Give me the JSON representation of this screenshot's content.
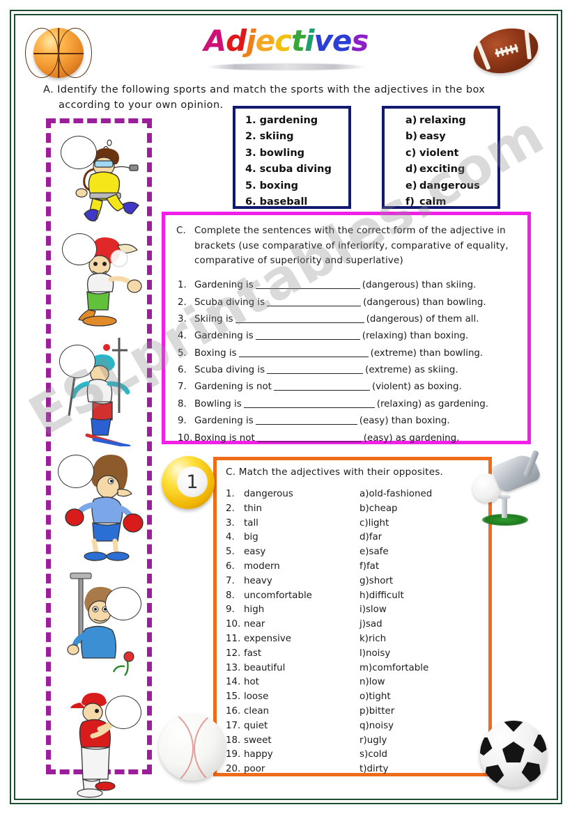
{
  "title": {
    "text": "Adjectives",
    "letters": [
      {
        "ch": "A",
        "color": "#cc1177"
      },
      {
        "ch": "d",
        "color": "#e01a1a"
      },
      {
        "ch": "j",
        "color": "#ef7d18"
      },
      {
        "ch": "e",
        "color": "#f5a623"
      },
      {
        "ch": "c",
        "color": "#f2c012"
      },
      {
        "ch": "t",
        "color": "#3aa63a"
      },
      {
        "ch": "i",
        "color": "#1f9e6e"
      },
      {
        "ch": "v",
        "color": "#2b3fd4"
      },
      {
        "ch": "e",
        "color": "#2b3fd4"
      },
      {
        "ch": "s",
        "color": "#8d1fc9"
      }
    ]
  },
  "decorations": {
    "basketball": "basketball-icon",
    "football": "american-football-icon",
    "soccer_ball": "soccer-ball-icon",
    "baseball": "baseball-icon",
    "billiard_ball_number": "1",
    "golf": "golf-club-and-ball-icon"
  },
  "watermark": {
    "text": "ESLprintables.com"
  },
  "section_a": {
    "line1": "A.  Identify  the  following  sports  and  match  the  sports  with  the  adjectives  in  the  box",
    "line2": "according to your own opinion.",
    "sports_box": {
      "items": [
        "1. gardening",
        "2. skiing",
        "3. bowling",
        "4. scuba diving",
        "5. boxing",
        "6. baseball"
      ]
    },
    "adjectives_box": {
      "items": [
        {
          "label": "a)",
          "word": "relaxing"
        },
        {
          "label": "b)",
          "word": "easy"
        },
        {
          "label": "c)",
          "word": "violent"
        },
        {
          "label": "d)",
          "word": "exciting"
        },
        {
          "label": "e)",
          "word": "dangerous"
        },
        {
          "label": "f)",
          "word": "calm"
        }
      ]
    },
    "illustrations": [
      {
        "name": "scuba-diver-illustration",
        "sport": "scuba diving"
      },
      {
        "name": "bowling-player-illustration",
        "sport": "bowling"
      },
      {
        "name": "skier-illustration",
        "sport": "skiing"
      },
      {
        "name": "boxer-illustration",
        "sport": "boxing"
      },
      {
        "name": "gardener-illustration",
        "sport": "gardening"
      },
      {
        "name": "baseball-batter-illustration",
        "sport": "baseball"
      }
    ]
  },
  "section_c_sentences": {
    "instruction_letter": "C.",
    "instruction_line1": "Complete the sentences with the correct form of the adjective in",
    "instruction_line2": "brackets (use comparative of inferiority, comparative of equality,",
    "instruction_line3": "comparative of superiority and superlative)",
    "items": [
      {
        "num": "1.",
        "before": "Gardening is",
        "blank_width": 150,
        "after": "(dangerous) than skiing."
      },
      {
        "num": "2.",
        "before": "Scuba diving is",
        "blank_width": 135,
        "after": "(dangerous) than bowling."
      },
      {
        "num": "3.",
        "before": "Skiing is",
        "blank_width": 185,
        "after": "(dangerous) of them all."
      },
      {
        "num": "4.",
        "before": "Gardening is",
        "blank_width": 150,
        "after": "(relaxing) than boxing."
      },
      {
        "num": "5.",
        "before": "Boxing is",
        "blank_width": 186,
        "after": "(extreme) than bowling."
      },
      {
        "num": "6.",
        "before": "Scuba diving is",
        "blank_width": 138,
        "after": "(extreme) as skiing."
      },
      {
        "num": "7.",
        "before": "Gardening is not",
        "blank_width": 138,
        "after": "(violent) as boxing."
      },
      {
        "num": "8.",
        "before": "Bowling is",
        "blank_width": 188,
        "after": "(relaxing) as gardening."
      },
      {
        "num": "9.",
        "before": "Gardening is",
        "blank_width": 146,
        "after": "(easy) than boxing."
      },
      {
        "num": "10.",
        "before": "Boxing is not",
        "blank_width": 150,
        "after": "(easy) as gardening."
      }
    ]
  },
  "section_c_matching": {
    "instruction": "C. Match the adjectives with their opposites.",
    "rows": [
      {
        "num": "1.",
        "word": "dangerous",
        "opt": "a)",
        "opposite": "old-fashioned"
      },
      {
        "num": "2.",
        "word": "thin",
        "opt": "b)",
        "opposite": "cheap"
      },
      {
        "num": "3.",
        "word": "tall",
        "opt": "c)",
        "opposite": "light"
      },
      {
        "num": "4.",
        "word": "big",
        "opt": "d)",
        "opposite": "far"
      },
      {
        "num": "5.",
        "word": "easy",
        "opt": "e)",
        "opposite": "safe"
      },
      {
        "num": "6.",
        "word": "modern",
        "opt": "f)",
        "opposite": "fat"
      },
      {
        "num": "7.",
        "word": "heavy",
        "opt": "g)",
        "opposite": "short"
      },
      {
        "num": "8.",
        "word": "uncomfortable",
        "opt": "h)",
        "opposite": "difficult"
      },
      {
        "num": "9.",
        "word": "high",
        "opt": "i)",
        "opposite": "slow"
      },
      {
        "num": "10.",
        "word": "near",
        "opt": "j)",
        "opposite": "sad"
      },
      {
        "num": "11.",
        "word": "expensive",
        "opt": "k)",
        "opposite": "rich"
      },
      {
        "num": "12.",
        "word": "fast",
        "opt": "l)",
        "opposite": "noisy"
      },
      {
        "num": "13.",
        "word": "beautiful",
        "opt": "m)",
        "opposite": "comfortable"
      },
      {
        "num": "14.",
        "word": "hot",
        "opt": "n)",
        "opposite": "low"
      },
      {
        "num": "15.",
        "word": "loose",
        "opt": "o)",
        "opposite": "tight"
      },
      {
        "num": "16.",
        "word": "clean",
        "opt": "p)",
        "opposite": "bitter"
      },
      {
        "num": "17.",
        "word": "quiet",
        "opt": "q)",
        "opposite": "noisy"
      },
      {
        "num": "18.",
        "word": "sweet",
        "opt": "r)",
        "opposite": "ugly"
      },
      {
        "num": "19.",
        "word": "happy",
        "opt": "s)",
        "opposite": "cold"
      },
      {
        "num": "20.",
        "word": "poor",
        "opt": "t)",
        "opposite": "dirty"
      }
    ]
  },
  "colors": {
    "frame": "#1b4d2e",
    "blue_box_border": "#111a6e",
    "pink_box_border": "#f020e8",
    "orange_box_border": "#ef6c1a",
    "dashed_column_border": "#9b1f9b"
  }
}
